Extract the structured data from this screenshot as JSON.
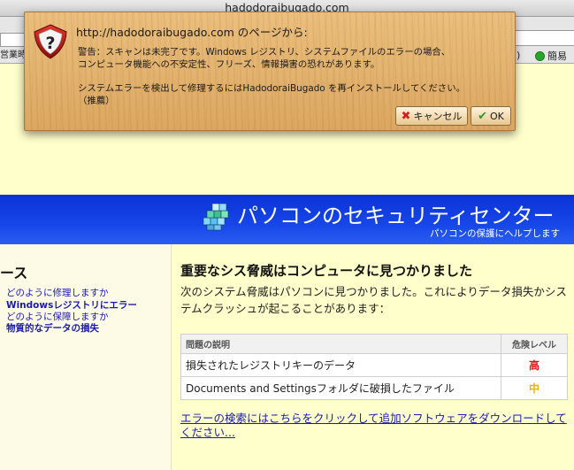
{
  "window": {
    "title": "hadodoraibugado.com"
  },
  "toolbar": {
    "left_field_text": "",
    "left_bookmark": "営業時",
    "right_paren": ")",
    "right_item": "簡易"
  },
  "dialog": {
    "title": "http://hadodoraibugado.com のページから:",
    "message_line1": "警告：スキャンは未完了です。Windows レジストリ、システムファイルのエラーの場合、",
    "message_line2": "コンピュータ機能への不安定性、フリーズ、情報損害の恐れがあります。",
    "message_line3": "システムエラーを検出して修理するにはHadodoraiBugado を再インストールしてください。",
    "message_line4": "（推薦）",
    "cancel_label": "キャンセル",
    "ok_label": "OK",
    "icon": "warning-question-icon"
  },
  "security_center": {
    "title": "パソコンのセキュリティセンター",
    "subtitle": "パソコンの保護にヘルプします",
    "logo_icon": "cube-grid-icon"
  },
  "leftnav": {
    "heading": "ース",
    "items": [
      {
        "label": "どのように修理しますか",
        "bold": false
      },
      {
        "label": "Windowsレジストリにエラー",
        "bold": true
      },
      {
        "label": "どのように保障しますか",
        "bold": false
      },
      {
        "label": "物質的なデータの損失",
        "bold": true
      }
    ]
  },
  "main": {
    "heading": "重要なシス脅威はコンピュータに見つかりました",
    "description": "次のシステム脅威はパソコンに見つかりました。これによりデータ損失かシステムクラッシュが起こることがあります：",
    "table": {
      "col_description": "問題の説明",
      "col_level": "危険レベル",
      "rows": [
        {
          "description": "損失されたレジストリキーのデータ",
          "level": "高",
          "level_color": "#e01010"
        },
        {
          "description": "Documents and Settingsフォルダに破損したファイル",
          "level": "中",
          "level_color": "#e8b400"
        }
      ]
    },
    "link": "エラーの検索にはこちらをクリックして追加ソフトウェアをダウンロードしてください..."
  },
  "colors": {
    "header_blue": "#1746e8",
    "page_bg": "#ffffcc",
    "dialog_wood": "#dca760"
  }
}
